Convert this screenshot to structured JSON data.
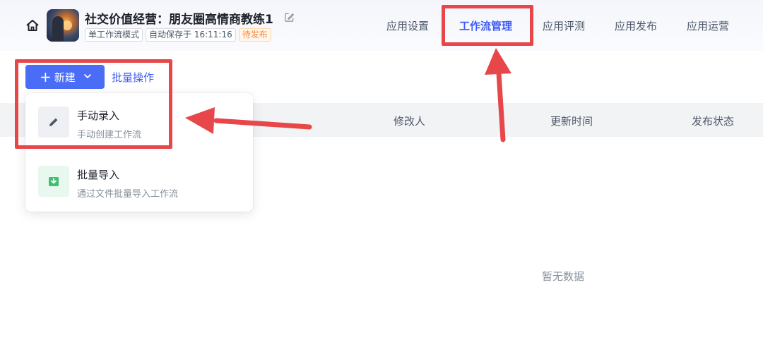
{
  "header": {
    "app_title": "社交价值经营：朋友圈高情商教练1",
    "tags": {
      "mode": "单工作流模式",
      "autosave": "自动保存于 16:11:16",
      "status": "待发布"
    },
    "nav_tabs": {
      "app_settings": "应用设置",
      "workflow_management": "工作流管理",
      "app_evaluation": "应用评测",
      "app_publish": "应用发布",
      "app_operations": "应用运营"
    },
    "active_tab": "工作流管理"
  },
  "toolbar": {
    "new_label": "新建",
    "batch_label": "批量操作"
  },
  "dropdown": {
    "manual": {
      "title": "手动录入",
      "desc": "手动创建工作流"
    },
    "import": {
      "title": "批量导入",
      "desc": "通过文件批量导入工作流"
    }
  },
  "table": {
    "columns": {
      "modifier": "修改人",
      "updated_time": "更新时间",
      "publish_status": "发布状态"
    },
    "empty_text": "暂无数据"
  },
  "colors": {
    "accent": "#3d5cf5",
    "primary_button": "#4a6cf7",
    "highlight_red": "#e8474a",
    "pending_orange": "#f7893b"
  }
}
